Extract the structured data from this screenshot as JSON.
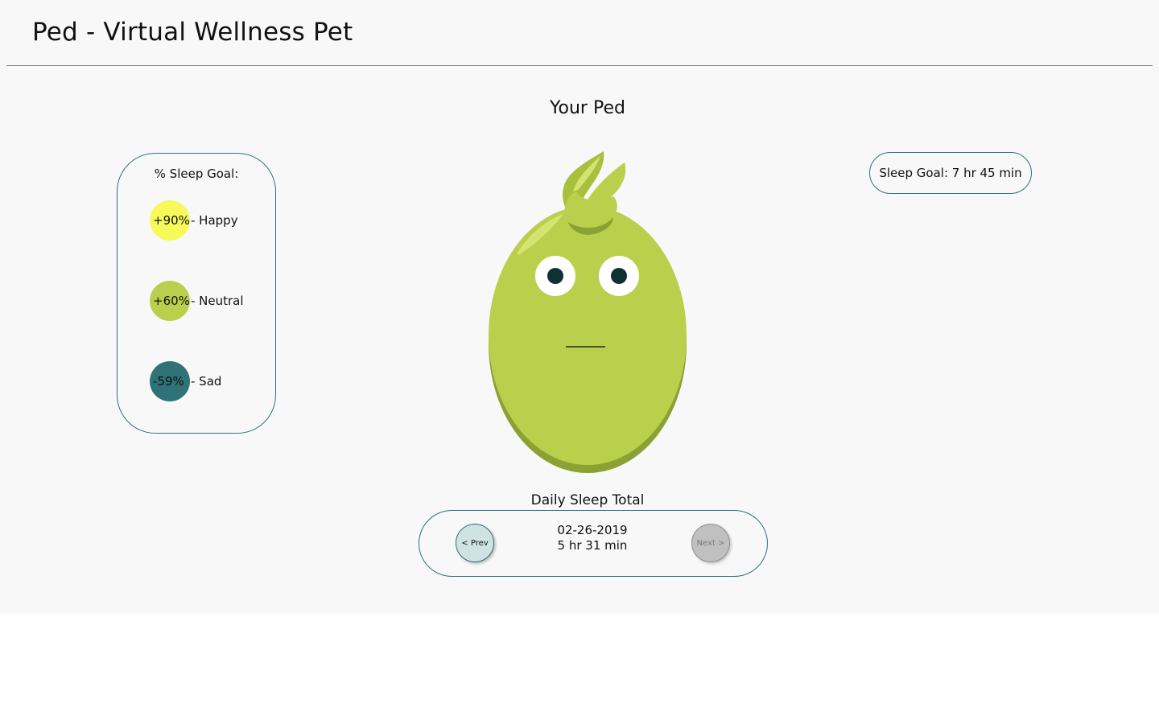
{
  "header": {
    "title": "Ped - Virtual Wellness Pet"
  },
  "main": {
    "section_title": "Your Ped"
  },
  "legend": {
    "title": "% Sleep Goal:",
    "items": [
      {
        "pct": "+90%",
        "label": "- Happy",
        "color": "#f7f95a"
      },
      {
        "pct": "+60%",
        "label": "- Neutral",
        "color": "#bad04c"
      },
      {
        "pct": "-59%",
        "label": "- Sad",
        "color": "#2f7278"
      }
    ]
  },
  "goal": {
    "label": "Sleep Goal: 7 hr 45 min"
  },
  "pet": {
    "mood": "neutral",
    "body_color": "#bad04c",
    "shadow_color": "#8ba133",
    "eye_color": "#0f3035"
  },
  "daily": {
    "label": "Daily Sleep Total",
    "date": "02-26-2019",
    "total": "5 hr 31 min",
    "prev_label": "< Prev",
    "next_label": "Next >"
  },
  "colors": {
    "accent": "#2f7279",
    "background": "#f8f8f8"
  }
}
